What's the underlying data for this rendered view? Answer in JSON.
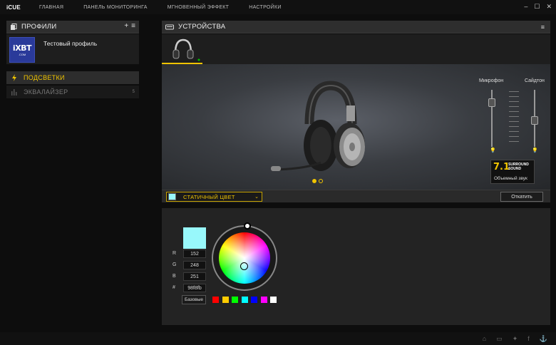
{
  "app": {
    "brand": "iCUE"
  },
  "nav": [
    "ГЛАВНАЯ",
    "ПАНЕЛЬ МОНИТОРИНГА",
    "МГНОВЕННЫЙ ЭФФЕКТ",
    "НАСТРОЙКИ"
  ],
  "window": {
    "minimize": "–",
    "maximize": "☐",
    "close": "✕"
  },
  "profiles": {
    "title": "ПРОФИЛИ",
    "add": "+",
    "menu": "≡",
    "avatar_text": "iXBT",
    "avatar_sub": ".COM",
    "profile_name": "Тестовый профиль",
    "items": [
      {
        "label": "ПОДСВЕТКИ",
        "active": true
      },
      {
        "label": "ЭКВАЛАЙЗЕР",
        "count": "5",
        "active": false
      }
    ]
  },
  "devices": {
    "title": "УСТРОЙСТВА",
    "menu": "≡",
    "mic_label": "Микрофон",
    "sidetone_label": "Сайдтон",
    "mic_level": 0.18,
    "sidetone_level": 0.55,
    "surround_big": "7.1",
    "surround_small_1": "SURROUND",
    "surround_small_2": "SOUND",
    "surround_caption": "Объемный звук",
    "pager_active": 0,
    "pager_count": 2
  },
  "effect": {
    "name": "СТАТИЧНЫЙ ЦВЕТ",
    "color": "#98f8fb",
    "revert_label": "Откатить"
  },
  "color_editor": {
    "r_label": "R",
    "g_label": "G",
    "b_label": "B",
    "hex_label": "#",
    "r": "152",
    "g": "248",
    "b": "251",
    "hex": "98f8fb",
    "presets_label": "Базовые",
    "presets": [
      "#ff0000",
      "#ffcc00",
      "#00ff00",
      "#00ffff",
      "#0000ff",
      "#ff00ff",
      "#ffffff"
    ]
  },
  "footer_icons": [
    "community-icon",
    "chat-icon",
    "twitter-icon",
    "facebook-icon",
    "corsair-icon"
  ],
  "colors": {
    "accent": "#f0c400"
  }
}
